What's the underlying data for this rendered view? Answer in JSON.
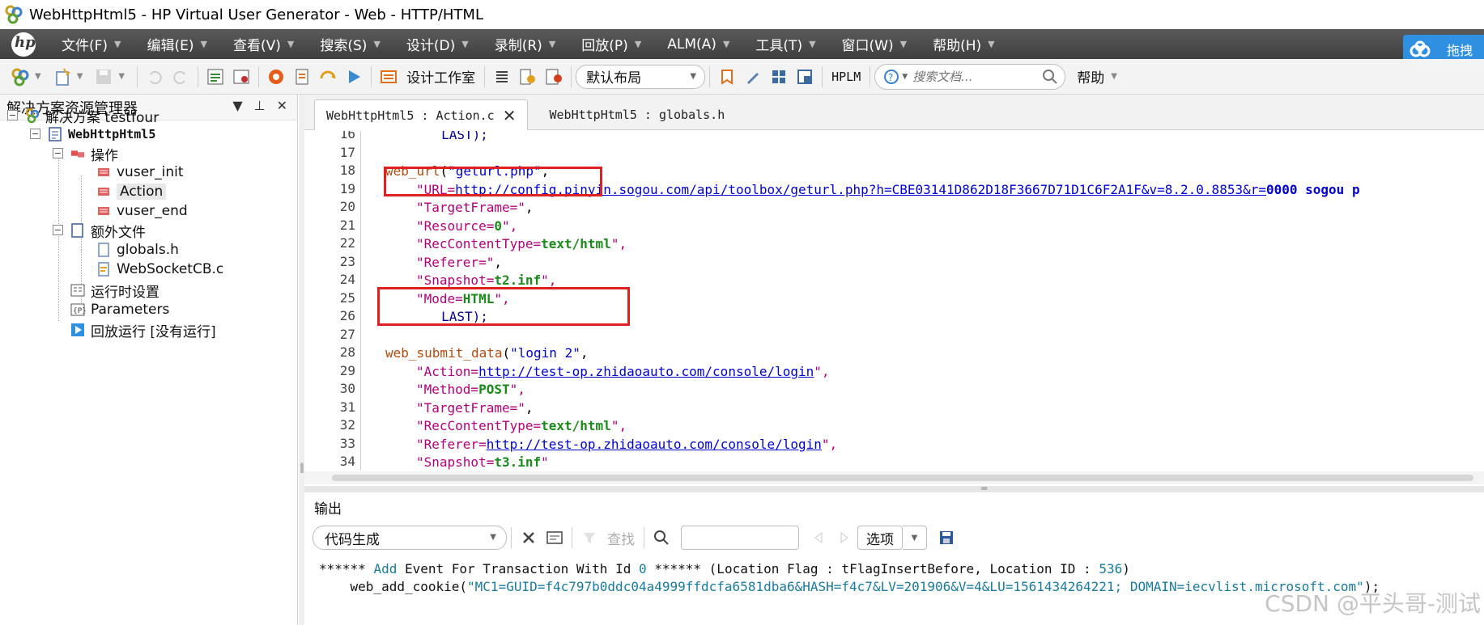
{
  "window": {
    "title": "WebHttpHtml5 - HP Virtual User Generator - Web - HTTP/HTML"
  },
  "menu": {
    "items": [
      "文件(F)",
      "编辑(E)",
      "查看(V)",
      "搜索(S)",
      "设计(D)",
      "录制(R)",
      "回放(P)",
      "ALM(A)",
      "工具(T)",
      "窗口(W)",
      "帮助(H)"
    ],
    "cloud_label": "拖拽"
  },
  "toolbar": {
    "design_studio": "设计工作室",
    "layout_value": "默认布局",
    "hplm_label": "HPLM",
    "search_placeholder": "搜索文档...",
    "help_label": "帮助"
  },
  "left_panel": {
    "title": "解决方案资源管理器",
    "tree": {
      "solution": "解决方案 testfour",
      "script": "WebHttpHtml5",
      "actions_folder": "操作",
      "vuser_init": "vuser_init",
      "action": "Action",
      "vuser_end": "vuser_end",
      "extra_files": "额外文件",
      "globals": "globals.h",
      "websocket": "WebSocketCB.c",
      "runtime_settings": "运行时设置",
      "parameters": "Parameters",
      "replay": "回放运行 [没有运行]"
    }
  },
  "editor": {
    "tabs": [
      {
        "label": "WebHttpHtml5 : Action.c",
        "active": true
      },
      {
        "label": "WebHttpHtml5 : globals.h",
        "active": false
      }
    ],
    "lines": [
      {
        "n": "16",
        "t": "        LAST);"
      },
      {
        "n": "17",
        "t": ""
      },
      {
        "n": "18",
        "f": "web_url",
        "a": "(",
        "s": "\"geturl.php\"",
        "b": ","
      },
      {
        "n": "19",
        "p": "\"URL=",
        "u": "http://config.pinyin.sogou.com/api/toolbox/geturl.php?h=CBE03141D862D18F3667D71D1C6F2A1F&v=8.2.0.8853&r=",
        "x": "0000 sogou p"
      },
      {
        "n": "20",
        "k": "\"TargetFrame=\"",
        "e": ","
      },
      {
        "n": "21",
        "k": "\"Resource=",
        "v": "0",
        "q": "\",",
        "e": ""
      },
      {
        "n": "22",
        "k": "\"RecContentType=",
        "v": "text/html",
        "q": "\",",
        "e": ""
      },
      {
        "n": "23",
        "k": "\"Referer=\"",
        "e": ","
      },
      {
        "n": "24",
        "k": "\"Snapshot=",
        "v": "t2.inf",
        "q": "\",",
        "e": ""
      },
      {
        "n": "25",
        "k": "\"Mode=",
        "v": "HTML",
        "q": "\",",
        "e": ""
      },
      {
        "n": "26",
        "t": "        LAST);"
      },
      {
        "n": "27",
        "t": ""
      },
      {
        "n": "28",
        "f": "web_submit_data",
        "a": "(",
        "s": "\"login 2\"",
        "b": ","
      },
      {
        "n": "29",
        "k": "\"Action=",
        "u": "http://test-op.zhidaoauto.com/console/login",
        "q": "\",",
        "e": ""
      },
      {
        "n": "30",
        "k": "\"Method=",
        "v": "POST",
        "q": "\",",
        "e": ""
      },
      {
        "n": "31",
        "k": "\"TargetFrame=\"",
        "e": ","
      },
      {
        "n": "32",
        "k": "\"RecContentType=",
        "v": "text/html",
        "q": "\",",
        "e": ""
      },
      {
        "n": "33",
        "k": "\"Referer=",
        "u": "http://test-op.zhidaoauto.com/console/login",
        "q": "\",",
        "e": ""
      },
      {
        "n": "34",
        "k": "\"Snapshot=",
        "v": "t3.inf",
        "q": "\"",
        "e": ""
      }
    ]
  },
  "output": {
    "title": "输出",
    "category": "代码生成",
    "find_label": "查找",
    "options_label": "选项",
    "line1": {
      "a": "****** ",
      "b": "Add",
      "c": " Event For Transaction With Id ",
      "d": "0",
      "e": " ****** (Location Flag : tFlagInsertBefore, Location ID : ",
      "f": "536",
      "g": ")"
    },
    "line2": {
      "a": "    web_add_cookie(",
      "b": "\"MC1=GUID=f4c797b0ddc04a4999ffdcfa6581dba6&HASH=f4c7&LV=201906&V=4&LU=1561434264221; DOMAIN=iecvlist.microsoft.com\"",
      "c": ");"
    },
    "watermark": "CSDN @平头哥-测试"
  },
  "colors": {
    "menu_bg": "#4a4a4a",
    "red_box": "#e02020",
    "cloud": "#2f8fe0"
  }
}
